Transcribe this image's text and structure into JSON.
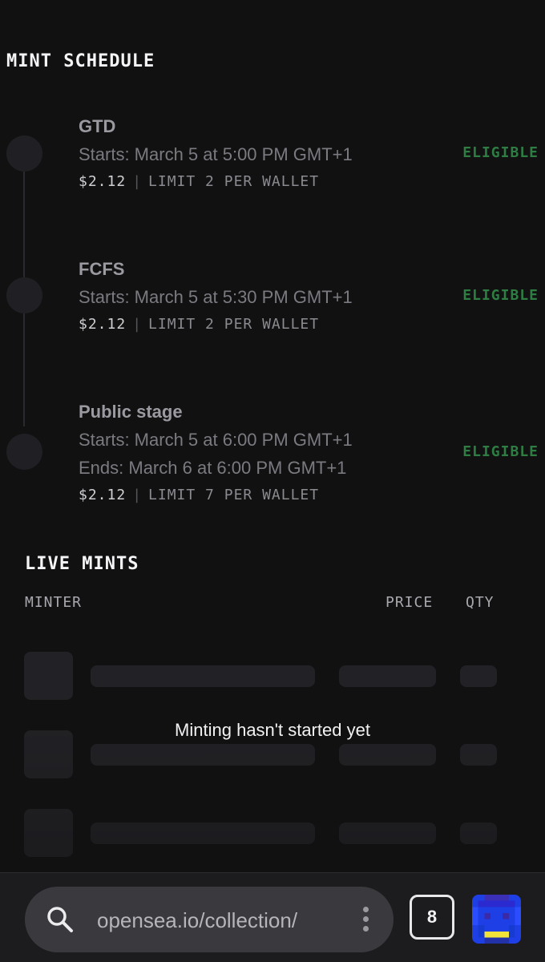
{
  "mint_schedule": {
    "title": "MINT SCHEDULE",
    "stages": [
      {
        "name": "GTD",
        "lines": [
          "Starts: March 5 at 5:00 PM GMT+1"
        ],
        "price": "$2.12",
        "separator": "|",
        "limit": "LIMIT 2 PER WALLET",
        "status": "ELIGIBLE"
      },
      {
        "name": "FCFS",
        "lines": [
          "Starts: March 5 at 5:30 PM GMT+1"
        ],
        "price": "$2.12",
        "separator": "|",
        "limit": "LIMIT 2 PER WALLET",
        "status": "ELIGIBLE"
      },
      {
        "name": "Public stage",
        "lines": [
          "Starts: March 5 at 6:00 PM GMT+1",
          "Ends: March 6 at 6:00 PM GMT+1"
        ],
        "price": "$2.12",
        "separator": "|",
        "limit": "LIMIT 7 PER WALLET",
        "status": "ELIGIBLE"
      }
    ]
  },
  "live_mints": {
    "title": "LIVE MINTS",
    "columns": {
      "minter": "MINTER",
      "price": "PRICE",
      "qty": "QTY"
    },
    "empty_message": "Minting hasn't started yet"
  },
  "browser": {
    "url": "opensea.io/collection/",
    "tab_count": "8",
    "icons": {
      "search": "search-icon",
      "menu": "more-vertical-icon",
      "tabs": "tabs-icon",
      "profile": "profile-avatar"
    }
  },
  "colors": {
    "background": "#111112",
    "eligible": "#2e7d43",
    "skeleton": "#232327"
  }
}
